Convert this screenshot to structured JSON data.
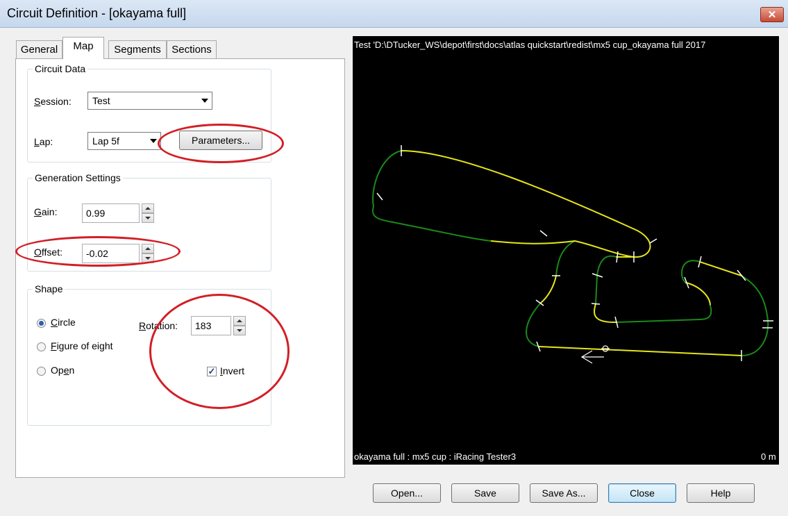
{
  "window": {
    "title": "Circuit Definition - [okayama full]",
    "close_glyph": "✕"
  },
  "tabs": [
    {
      "label": "General",
      "active": false
    },
    {
      "label": "Map",
      "active": true
    },
    {
      "label": "Segments",
      "active": false
    },
    {
      "label": "Sections",
      "active": false
    }
  ],
  "circuit_data": {
    "legend": "Circuit Data",
    "session_label": "Session:",
    "session_value": "Test",
    "lap_label": "Lap:",
    "lap_value": "Lap 5f",
    "parameters_button": "Parameters..."
  },
  "generation": {
    "legend": "Generation Settings",
    "gain_label": "Gain:",
    "gain_value": "0.99",
    "offset_label": "Offset:",
    "offset_value": "-0.02"
  },
  "shape": {
    "legend": "Shape",
    "options": [
      "Circle",
      "Figure of eight",
      "Open"
    ],
    "selected": "Circle",
    "rotation_label": "Rotation:",
    "rotation_value": "183",
    "invert_label": "Invert",
    "invert_checked": true
  },
  "map": {
    "header_text": "Test  'D:\\DTucker_WS\\depot\\first\\docs\\atlas quickstart\\redist\\mx5 cup_okayama full 2017",
    "footer_left": "okayama full : mx5 cup : iRacing Tester3",
    "footer_right": "0 m",
    "track_colors": {
      "green": "#1a8a1a",
      "yellow": "#e6e619",
      "markers": "#ffffff"
    },
    "background": "#000000"
  },
  "buttons": {
    "open": "Open...",
    "save": "Save",
    "save_as": "Save As...",
    "close": "Close",
    "help": "Help"
  },
  "annotations": {
    "ring_color": "#d21f26"
  }
}
